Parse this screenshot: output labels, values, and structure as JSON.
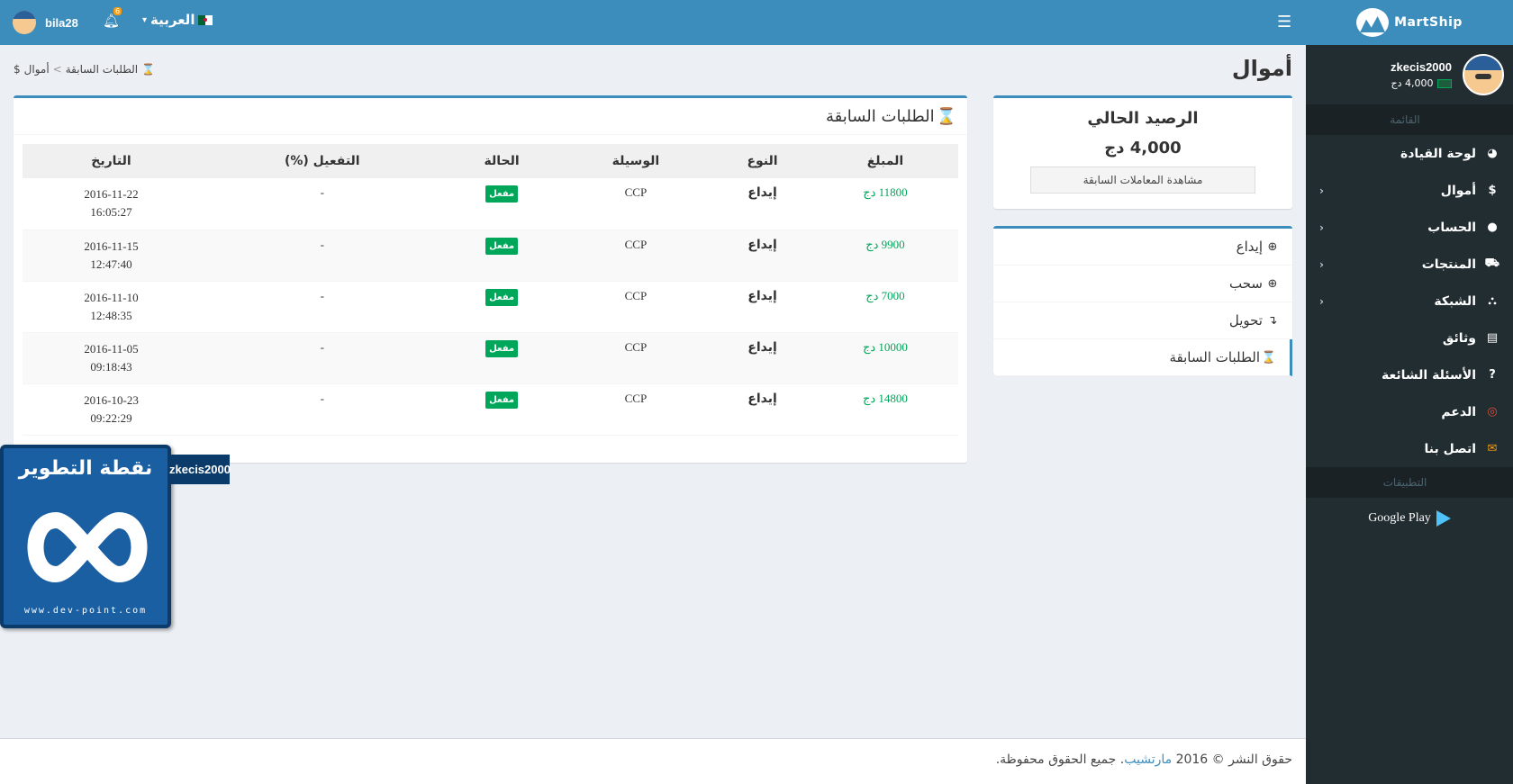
{
  "app": {
    "name": "MartShip"
  },
  "topbar": {
    "username": "bila28",
    "notifications_count": "6",
    "language": "العربية"
  },
  "sidebar": {
    "user": {
      "name": "zkecis2000",
      "balance": "4,000 دج"
    },
    "menu_header": "القائمة",
    "items": [
      {
        "label": "لوحة القيادة",
        "icon": "dashboard-icon"
      },
      {
        "label": "أموال",
        "icon": "dollar-icon"
      },
      {
        "label": "الحساب",
        "icon": "user-icon"
      },
      {
        "label": "المنتجات",
        "icon": "cart-icon"
      },
      {
        "label": "الشبكة",
        "icon": "sitemap-icon"
      },
      {
        "label": "وثائق",
        "icon": "newspaper-icon"
      },
      {
        "label": "الأسئلة الشائعة",
        "icon": "question-icon"
      },
      {
        "label": "الدعم",
        "icon": "lifebuoy-icon"
      },
      {
        "label": "اتصل بنا",
        "icon": "envelope-icon"
      }
    ],
    "apps_header": "التطبيقات",
    "google_play": "Google Play"
  },
  "page": {
    "title": "أموال",
    "breadcrumb": {
      "root": "أموال",
      "current": "الطلبات السابقة"
    }
  },
  "balance_box": {
    "title": "الرصيد الحالي",
    "amount": "4,000 دج",
    "button": "مشاهدة المعاملات السابقة"
  },
  "actions": [
    {
      "label": "إيداع",
      "icon": "arrow-circle-down-icon"
    },
    {
      "label": "سحب",
      "icon": "arrow-circle-up-icon"
    },
    {
      "label": "تحويل",
      "icon": "transfer-icon"
    },
    {
      "label": "الطلبات السابقة",
      "icon": "hourglass-icon"
    }
  ],
  "orders": {
    "title": "الطلبات السابقة",
    "columns": [
      "المبلغ",
      "النوع",
      "الوسيلة",
      "الحالة",
      "التفعيل (%)",
      "التاريخ"
    ],
    "rows": [
      {
        "amount": "11800 دج",
        "type": "إيداع",
        "method": "CCP",
        "status": "مفعل",
        "activation": "-",
        "date": "2016-11-22",
        "time": "16:05:27"
      },
      {
        "amount": "9900 دج",
        "type": "إيداع",
        "method": "CCP",
        "status": "مفعل",
        "activation": "-",
        "date": "2016-11-15",
        "time": "12:47:40"
      },
      {
        "amount": "7000 دج",
        "type": "إيداع",
        "method": "CCP",
        "status": "مفعل",
        "activation": "-",
        "date": "2016-11-10",
        "time": "12:48:35"
      },
      {
        "amount": "10000 دج",
        "type": "إيداع",
        "method": "CCP",
        "status": "مفعل",
        "activation": "-",
        "date": "2016-11-05",
        "time": "09:18:43"
      },
      {
        "amount": "14800 دج",
        "type": "إيداع",
        "method": "CCP",
        "status": "مفعل",
        "activation": "-",
        "date": "2016-10-23",
        "time": "09:22:29"
      }
    ]
  },
  "footer": {
    "prefix": "حقوق النشر © 2016",
    "link": "مارتشيب",
    "suffix": ". جميع الحقوق محفوظة."
  },
  "watermark": {
    "title": "نقطة التطوير",
    "url": "www.dev-point.com",
    "tag": "zkecis2000"
  },
  "colors": {
    "primary": "#3c8dbc",
    "sidebar_bg": "#222d32",
    "success": "#00a65a",
    "content_bg": "#ecf0f5"
  }
}
